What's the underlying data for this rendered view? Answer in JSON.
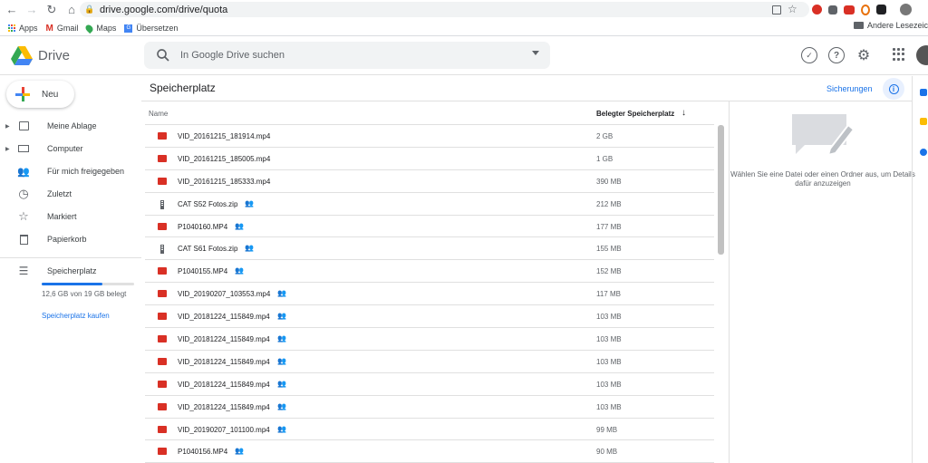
{
  "browser": {
    "url": "drive.google.com/drive/quota",
    "bookmarks": [
      "Apps",
      "Gmail",
      "Maps",
      "Übersetzen"
    ],
    "other_bookmarks": "Andere Lesezeic"
  },
  "drive": {
    "app_name": "Drive",
    "search_placeholder": "In Google Drive suchen"
  },
  "sidebar": {
    "new_label": "Neu",
    "items": [
      {
        "label": "Meine Ablage"
      },
      {
        "label": "Computer"
      },
      {
        "label": "Für mich freigegeben"
      },
      {
        "label": "Zuletzt"
      },
      {
        "label": "Markiert"
      },
      {
        "label": "Papierkorb"
      }
    ],
    "storage_label": "Speicherplatz",
    "storage_used_fraction": 0.66,
    "storage_text": "12,6 GB von 19 GB belegt",
    "buy_storage": "Speicherplatz kaufen"
  },
  "main": {
    "title": "Speicherplatz",
    "backups_link": "Sicherungen",
    "col_name": "Name",
    "col_size": "Belegter Speicherplatz",
    "files": [
      {
        "name": "VID_20161215_181914.mp4",
        "size": "2 GB",
        "type": "video",
        "shared": false
      },
      {
        "name": "VID_20161215_185005.mp4",
        "size": "1 GB",
        "type": "video",
        "shared": false
      },
      {
        "name": "VID_20161215_185333.mp4",
        "size": "390 MB",
        "type": "video",
        "shared": false
      },
      {
        "name": "CAT S52 Fotos.zip",
        "size": "212 MB",
        "type": "zip",
        "shared": true
      },
      {
        "name": "P1040160.MP4",
        "size": "177 MB",
        "type": "video",
        "shared": true
      },
      {
        "name": "CAT S61 Fotos.zip",
        "size": "155 MB",
        "type": "zip",
        "shared": true
      },
      {
        "name": "P1040155.MP4",
        "size": "152 MB",
        "type": "video",
        "shared": true
      },
      {
        "name": "VID_20190207_103553.mp4",
        "size": "117 MB",
        "type": "video",
        "shared": true
      },
      {
        "name": "VID_20181224_115849.mp4",
        "size": "103 MB",
        "type": "video",
        "shared": true
      },
      {
        "name": "VID_20181224_115849.mp4",
        "size": "103 MB",
        "type": "video",
        "shared": true
      },
      {
        "name": "VID_20181224_115849.mp4",
        "size": "103 MB",
        "type": "video",
        "shared": true
      },
      {
        "name": "VID_20181224_115849.mp4",
        "size": "103 MB",
        "type": "video",
        "shared": true
      },
      {
        "name": "VID_20181224_115849.mp4",
        "size": "103 MB",
        "type": "video",
        "shared": true
      },
      {
        "name": "VID_20190207_101100.mp4",
        "size": "99 MB",
        "type": "video",
        "shared": true
      },
      {
        "name": "P1040156.MP4",
        "size": "90 MB",
        "type": "video",
        "shared": true
      }
    ],
    "detail_text": "Wählen Sie eine Datei oder einen Ordner aus, um Details dafür anzuzeigen"
  },
  "colors": {
    "accent": "#1a73e8",
    "video_icon": "#d93025",
    "text_secondary": "#5f6368"
  },
  "icons": [
    "back-icon",
    "forward-icon",
    "reload-icon",
    "home-icon",
    "lock-icon",
    "share-icon",
    "star-icon",
    "search-icon",
    "offline-icon",
    "help-icon",
    "gear-icon",
    "apps-grid-icon",
    "info-icon",
    "people-icon",
    "film-icon",
    "zip-icon"
  ]
}
